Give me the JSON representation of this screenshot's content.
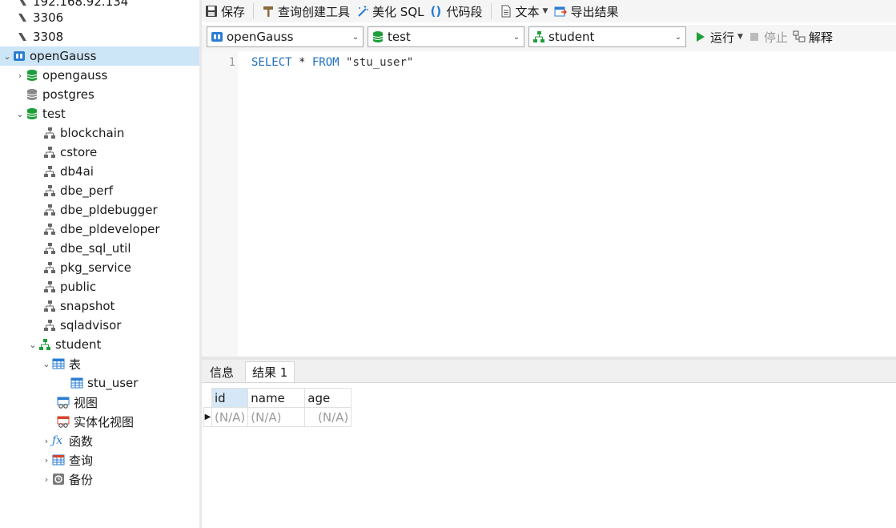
{
  "colors": {
    "db_green": "#1e9e3a",
    "accent_blue": "#1f6fbf",
    "selected_bg": "#cde6f7",
    "disabled": "#9b9b9b"
  },
  "sidebar": {
    "items": [
      {
        "label": "192.168.92.134",
        "icon": "mysql-connection-icon"
      },
      {
        "label": "3306",
        "icon": "mysql-connection-icon"
      },
      {
        "label": "3308",
        "icon": "mysql-connection-icon"
      },
      {
        "label": "openGauss",
        "icon": "opengauss-connection-icon"
      },
      {
        "label": "opengauss",
        "icon": "database-icon"
      },
      {
        "label": "postgres",
        "icon": "database-icon"
      },
      {
        "label": "test",
        "icon": "database-icon"
      },
      {
        "label": "blockchain",
        "icon": "schema-icon"
      },
      {
        "label": "cstore",
        "icon": "schema-icon"
      },
      {
        "label": "db4ai",
        "icon": "schema-icon"
      },
      {
        "label": "dbe_perf",
        "icon": "schema-icon"
      },
      {
        "label": "dbe_pldebugger",
        "icon": "schema-icon"
      },
      {
        "label": "dbe_pldeveloper",
        "icon": "schema-icon"
      },
      {
        "label": "dbe_sql_util",
        "icon": "schema-icon"
      },
      {
        "label": "pkg_service",
        "icon": "schema-icon"
      },
      {
        "label": "public",
        "icon": "schema-icon"
      },
      {
        "label": "snapshot",
        "icon": "schema-icon"
      },
      {
        "label": "sqladvisor",
        "icon": "schema-icon"
      },
      {
        "label": "student",
        "icon": "schema-icon"
      },
      {
        "label": "表",
        "icon": "tables-icon"
      },
      {
        "label": "stu_user",
        "icon": "table-icon"
      },
      {
        "label": "视图",
        "icon": "views-icon"
      },
      {
        "label": "实体化视图",
        "icon": "materialized-views-icon"
      },
      {
        "label": "函数",
        "icon": "function-icon"
      },
      {
        "label": "查询",
        "icon": "query-icon"
      },
      {
        "label": "备份",
        "icon": "backup-icon"
      }
    ]
  },
  "toolbar": {
    "save": "保存",
    "query_builder": "查询创建工具",
    "beautify": "美化 SQL",
    "snippet": "代码段",
    "text": "文本",
    "export": "导出结果"
  },
  "connection": {
    "server": "openGauss",
    "database": "test",
    "schema": "student",
    "run": "运行",
    "stop": "停止",
    "explain": "解释"
  },
  "editor": {
    "line_number": "1",
    "kw_select": "SELECT",
    "star": " * ",
    "kw_from": "FROM",
    "table_literal": " \"stu_user\""
  },
  "result_tabs": [
    "信息",
    "结果 1"
  ],
  "result_grid": {
    "columns": [
      "id",
      "name",
      "age"
    ],
    "rows": [
      [
        "(N/A)",
        "(N/A)",
        "(N/A)"
      ]
    ]
  }
}
